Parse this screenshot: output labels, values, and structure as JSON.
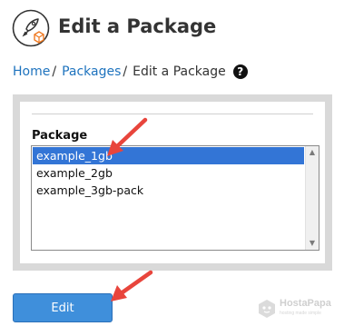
{
  "header": {
    "title": "Edit a Package",
    "icon": "package-rocket-icon"
  },
  "breadcrumb": {
    "home_label": "Home",
    "packages_label": "Packages",
    "current_label": "Edit a Package",
    "separator": "/",
    "help_icon": "help-circle-icon"
  },
  "form": {
    "package_label": "Package",
    "options": [
      {
        "label": "example_1gb",
        "selected": true
      },
      {
        "label": "example_2gb",
        "selected": false
      },
      {
        "label": "example_3gb-pack",
        "selected": false
      }
    ]
  },
  "actions": {
    "edit_label": "Edit"
  },
  "watermark": {
    "brand": "HostaPapa",
    "tagline": "hosting made simple"
  },
  "annotations": {
    "arrow_color": "#e8453c"
  },
  "colors": {
    "accent": "#3f8fdb",
    "selection": "#3375d6",
    "link": "#1e73be"
  }
}
